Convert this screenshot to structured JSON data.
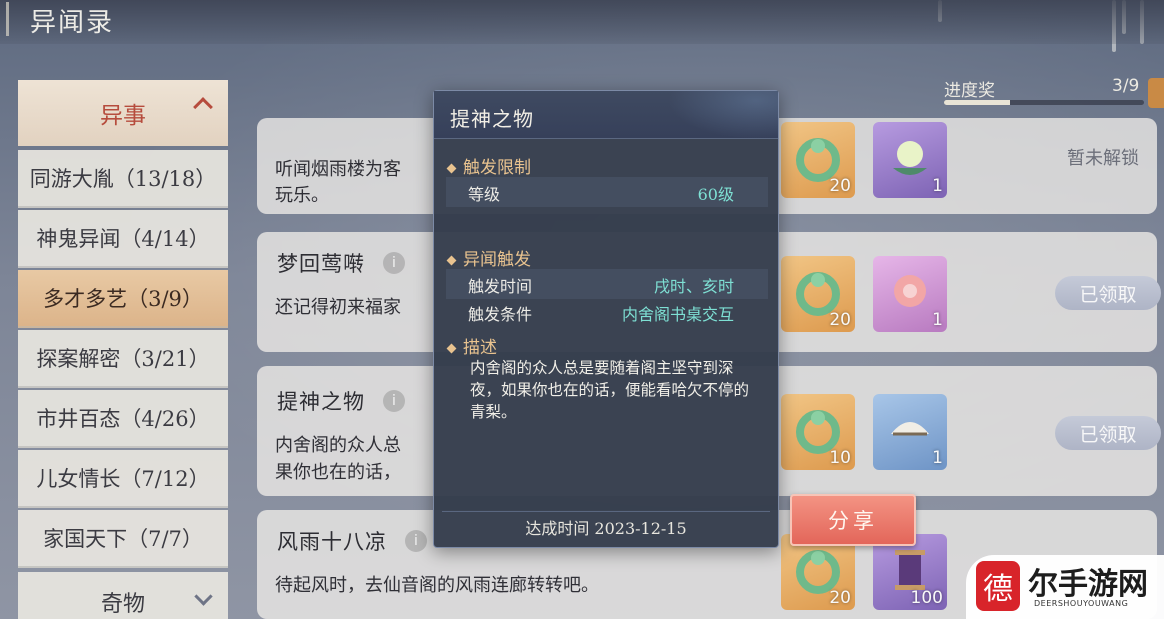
{
  "page": {
    "title": "异闻录"
  },
  "progress": {
    "label": "进度奖",
    "count": "3/9",
    "fraction": 0.33
  },
  "sidebar": {
    "header": "异事",
    "items": [
      {
        "label": "同游大胤（13/18）",
        "active": false
      },
      {
        "label": "神鬼异闻（4/14）",
        "active": false
      },
      {
        "label": "多才多艺（3/9）",
        "active": true
      },
      {
        "label": "探案解密（3/21）",
        "active": false
      },
      {
        "label": "市井百态（4/26）",
        "active": false
      },
      {
        "label": "儿女情长（7/12）",
        "active": false
      },
      {
        "label": "家国天下（7/7）",
        "active": false
      }
    ],
    "footer": "奇物"
  },
  "cards": [
    {
      "title": "",
      "desc": "听闻烟雨楼为客",
      "desc2": "玩乐。",
      "status": "暂未解锁",
      "rewards": [
        {
          "count": "20",
          "color": "orange"
        },
        {
          "count": "1",
          "color": "purple"
        }
      ]
    },
    {
      "title": "梦回莺啭",
      "desc": "还记得初来福家",
      "status": "已领取",
      "rewards": [
        {
          "count": "20",
          "color": "orange"
        },
        {
          "count": "1",
          "color": "pink"
        }
      ]
    },
    {
      "title": "提神之物",
      "desc": "内舍阁的众人总",
      "desc2": "果你也在的话，",
      "status": "已领取",
      "rewards": [
        {
          "count": "10",
          "color": "orange"
        },
        {
          "count": "1",
          "color": "blue"
        }
      ]
    },
    {
      "title": "风雨十八凉",
      "desc": "待起风时，去仙音阁的风雨连廊转转吧。",
      "status": "",
      "rewards": [
        {
          "count": "20",
          "color": "orange"
        },
        {
          "count": "100",
          "color": "purple"
        }
      ]
    }
  ],
  "modal": {
    "title": "提神之物",
    "section_limit": "触发限制",
    "level_label": "等级",
    "level_value": "60级",
    "section_trigger": "异闻触发",
    "time_label": "触发时间",
    "time_value": "戌时、亥时",
    "cond_label": "触发条件",
    "cond_value": "内舍阁书桌交互",
    "section_desc": "描述",
    "desc": "内舍阁的众人总是要随着阁主坚守到深夜，如果你也在的话，便能看哈欠不停的青梨。",
    "achieve_time": "达成时间 2023-12-15"
  },
  "share_label": "分享",
  "watermark": {
    "seal": "德",
    "text": "尔手游网",
    "sub": "DEERSHOUYOUWANG"
  },
  "colors": {
    "accent": "#e9c38f",
    "value": "#7ee0d4",
    "share": "#e3665a",
    "active_tab": "#dcb48a"
  }
}
